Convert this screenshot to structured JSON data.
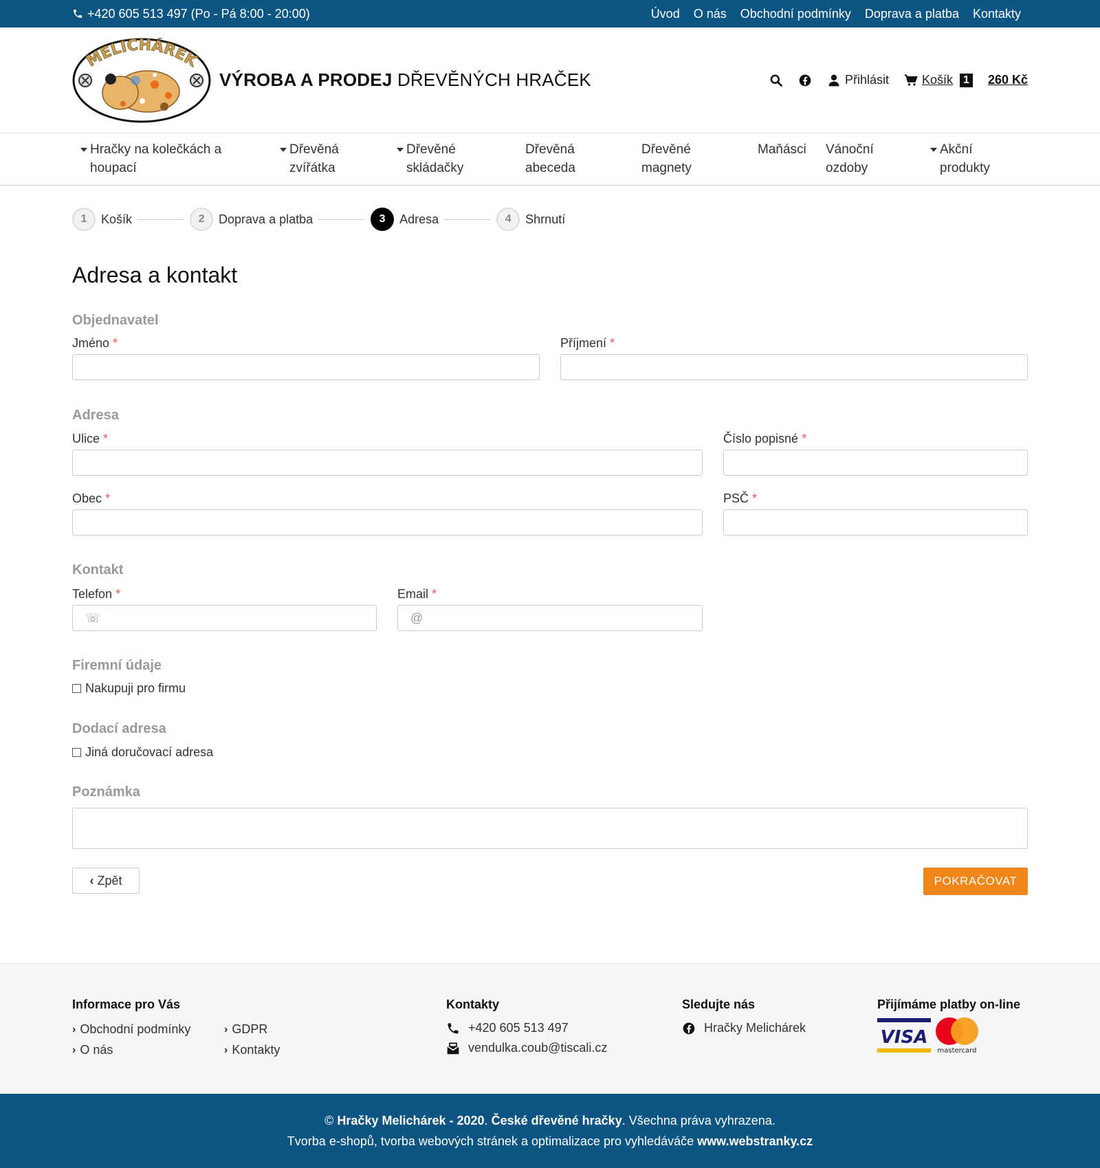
{
  "topbar": {
    "phone": "+420 605 513 497 (Po - Pá 8:00 - 20:00)",
    "links": [
      "Úvod",
      "O nás",
      "Obchodní podmínky",
      "Doprava a platba",
      "Kontakty"
    ]
  },
  "header": {
    "logo_text": "MELICHÁREK",
    "tagline_bold": "VÝROBA A PRODEJ",
    "tagline_rest": "DŘEVĚNÝCH HRAČEK",
    "login": "Přihlásit",
    "cart_label": "Košík",
    "cart_count": "1",
    "cart_price": "260 Kč"
  },
  "mainnav": [
    {
      "line1": "Hračky na kolečkách a",
      "line2": "houpací",
      "dropdown": true
    },
    {
      "line1": "Dřevěná",
      "line2": "zvířátka",
      "dropdown": true
    },
    {
      "line1": "Dřevěné",
      "line2": "skládačky",
      "dropdown": true
    },
    {
      "line1": "Dřevěná",
      "line2": "abeceda",
      "dropdown": false
    },
    {
      "line1": "Dřevěné",
      "line2": "magnety",
      "dropdown": false
    },
    {
      "line1": "Maňásci",
      "line2": "",
      "dropdown": false
    },
    {
      "line1": "Vánoční",
      "line2": "ozdoby",
      "dropdown": false
    },
    {
      "line1": "Akční",
      "line2": "produkty",
      "dropdown": true
    }
  ],
  "steps": [
    {
      "num": "1",
      "label": "Košík"
    },
    {
      "num": "2",
      "label": "Doprava a platba"
    },
    {
      "num": "3",
      "label": "Adresa"
    },
    {
      "num": "4",
      "label": "Shrnutí"
    }
  ],
  "form": {
    "title": "Adresa a kontakt",
    "required_mark": "*",
    "sections": {
      "customer": "Objednavatel",
      "address": "Adresa",
      "contact": "Kontakt",
      "company": "Firemní údaje",
      "delivery": "Dodací adresa",
      "note": "Poznámka"
    },
    "labels": {
      "first_name": "Jméno",
      "last_name": "Příjmení",
      "street": "Ulice",
      "house_number": "Číslo popisné",
      "city": "Obec",
      "zip": "PSČ",
      "phone": "Telefon",
      "email": "Email"
    },
    "placeholders": {
      "phone": "☏",
      "email": "@"
    },
    "checkboxes": {
      "company": "Nakupuji pro firmu",
      "delivery": "Jiná doručovací adresa"
    },
    "back_button": "Zpět",
    "next_button": "POKRAČOVAT"
  },
  "footer": {
    "info_title": "Informace pro Vás",
    "info_links_col1": [
      "Obchodní podmínky",
      "O nás"
    ],
    "info_links_col2": [
      "GDPR",
      "Kontakty"
    ],
    "contacts_title": "Kontakty",
    "phone": "+420 605 513 497",
    "email": "vendulka.coub@tiscali.cz",
    "follow_title": "Sledujte nás",
    "facebook": "Hračky Melichárek",
    "payments_title": "Přijímáme platby on-line",
    "visa": "VISA",
    "mastercard": "mastercard"
  },
  "bottom": {
    "copyright_prefix": "©",
    "company": "Hračky Melichárek - 2020",
    "slogan": "České dřevěné hračky",
    "rights": ". Všechna práva vyhrazena.",
    "credits": "Tvorba e-shopů, tvorba webových stránek a optimalizace pro vyhledáváče",
    "credits_link": "www.webstranky.cz"
  },
  "colors": {
    "primary": "#0d5583",
    "accent": "#f0861a",
    "section_gray": "#999999",
    "required": "#ee5555"
  }
}
